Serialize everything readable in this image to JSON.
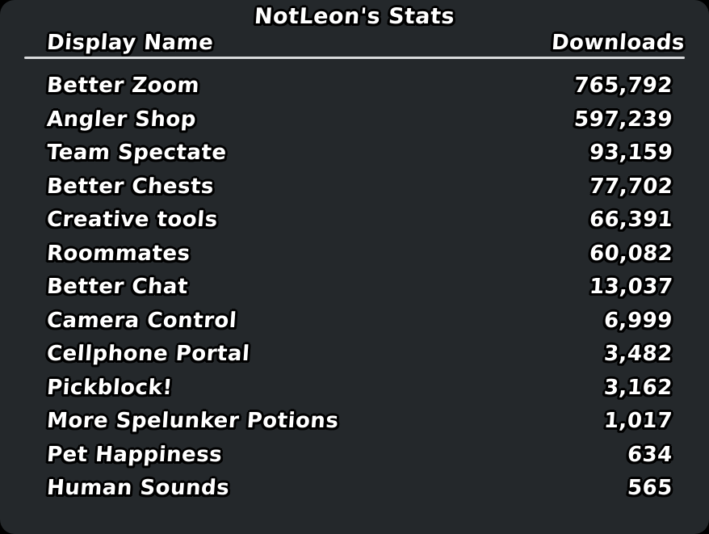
{
  "panel": {
    "title": "NotLeon's Stats",
    "background_color": "#24282b",
    "outside_color": "#000000",
    "text_color": "#ffffff",
    "outline_color": "#000000",
    "divider_color": "#d9dbdc"
  },
  "table": {
    "columns": [
      {
        "key": "display_name",
        "label": "Display Name",
        "align": "left"
      },
      {
        "key": "downloads",
        "label": "Downloads",
        "align": "right"
      }
    ],
    "rows": [
      {
        "display_name": "Better Zoom",
        "downloads": "765,792",
        "downloads_value": 765792
      },
      {
        "display_name": "Angler Shop",
        "downloads": "597,239",
        "downloads_value": 597239
      },
      {
        "display_name": "Team Spectate",
        "downloads": "93,159",
        "downloads_value": 93159
      },
      {
        "display_name": "Better Chests",
        "downloads": "77,702",
        "downloads_value": 77702
      },
      {
        "display_name": "Creative tools",
        "downloads": "66,391",
        "downloads_value": 66391
      },
      {
        "display_name": "Roommates",
        "downloads": "60,082",
        "downloads_value": 60082
      },
      {
        "display_name": "Better Chat",
        "downloads": "13,037",
        "downloads_value": 13037
      },
      {
        "display_name": "Camera Control",
        "downloads": "6,999",
        "downloads_value": 6999
      },
      {
        "display_name": "Cellphone Portal",
        "downloads": "3,482",
        "downloads_value": 3482
      },
      {
        "display_name": "Pickblock!",
        "downloads": "3,162",
        "downloads_value": 3162
      },
      {
        "display_name": "More Spelunker Potions",
        "downloads": "1,017",
        "downloads_value": 1017
      },
      {
        "display_name": "Pet Happiness",
        "downloads": "634",
        "downloads_value": 634
      },
      {
        "display_name": "Human Sounds",
        "downloads": "565",
        "downloads_value": 565
      }
    ]
  }
}
